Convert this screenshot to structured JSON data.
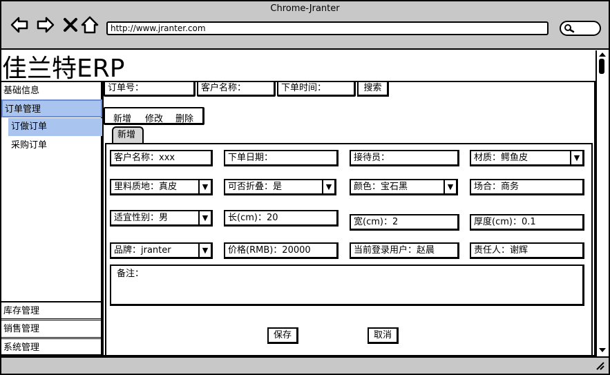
{
  "window": {
    "title": "Chrome-Jranter",
    "url": "http://www.jranter.com"
  },
  "brand": "佳兰特ERP",
  "sidebar": {
    "items": [
      {
        "label": "基础信息"
      },
      {
        "label": "订单管理"
      },
      {
        "label": "订做订单"
      },
      {
        "label": "采购订单"
      }
    ],
    "bottom_items": [
      {
        "label": "库存管理"
      },
      {
        "label": "销售管理"
      },
      {
        "label": "系统管理"
      }
    ]
  },
  "search_bar": {
    "order_no": "订单号：",
    "customer": "客户名称：",
    "order_time": "下单时间：",
    "search_button": "搜索"
  },
  "toolbar": {
    "add": "新增",
    "edit": "修改",
    "delete": "删除"
  },
  "tab": {
    "label": "新增"
  },
  "form": {
    "customer_name": "客户名称：xxx",
    "order_date": "下单日期：",
    "receptionist": "接待员：",
    "material": "材质：鳄鱼皮",
    "lining": "里料质地：真皮",
    "foldable": "可否折叠：是",
    "color": "颜色：宝石黑",
    "occasion": "场合：商务",
    "gender": "适宜性别：男",
    "length": "长(cm)：20",
    "width": "宽(cm)：2",
    "thickness": "厚度(cm)：0.1",
    "brand": "品牌：jranter",
    "price": "价格(RMB)：20000",
    "current_user": "当前登录用户：赵晨",
    "owner": "责任人：谢辉",
    "remarks": "备注：",
    "save": "保存",
    "cancel": "取消"
  },
  "icons": [
    "back-icon",
    "forward-icon",
    "close-icon",
    "home-icon",
    "search-icon",
    "dropdown-arrow-icon",
    "resize-grip-icon"
  ]
}
